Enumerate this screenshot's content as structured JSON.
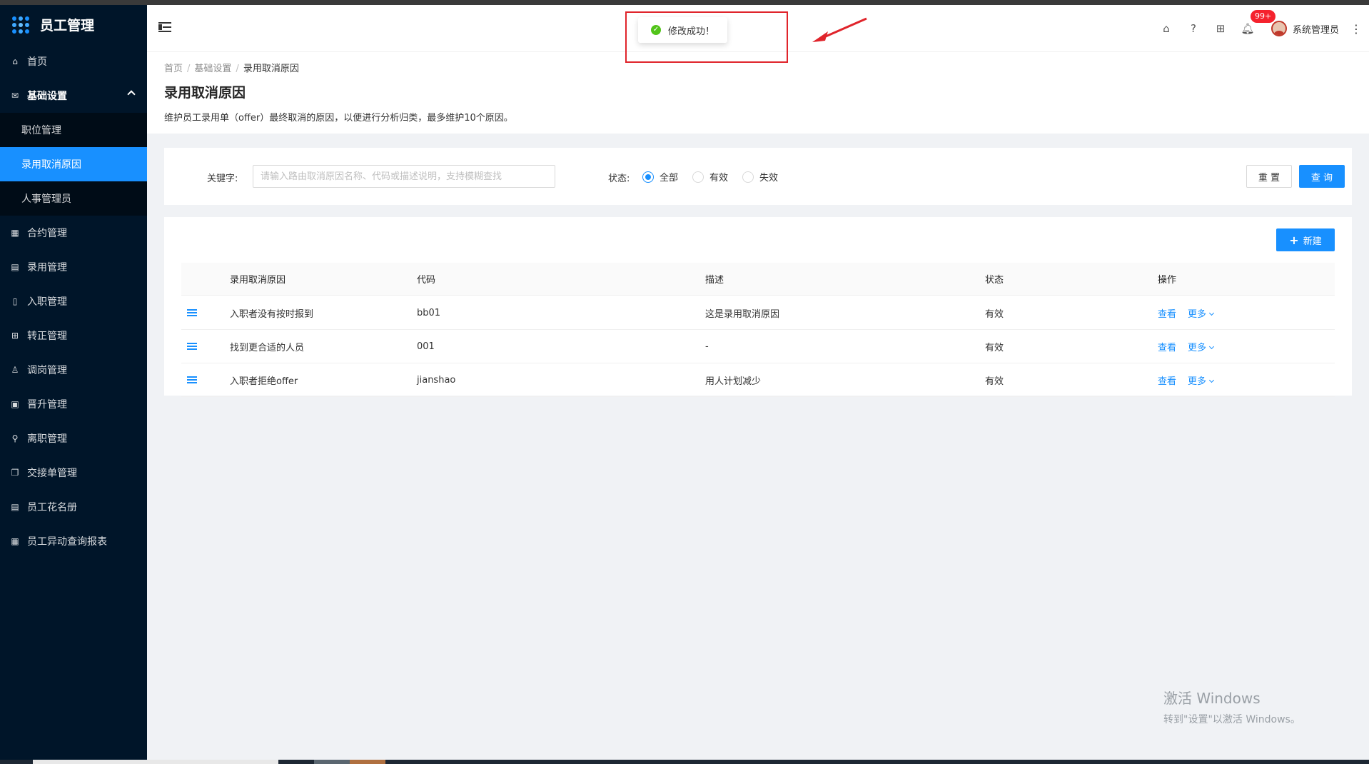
{
  "app": {
    "title": "员工管理"
  },
  "sidebar": {
    "items": [
      {
        "label": "首页",
        "icon": "home-icon",
        "glyph": "⌂"
      },
      {
        "label": "基础设置",
        "icon": "mail-icon",
        "glyph": "✉",
        "open": true,
        "children": [
          {
            "label": "职位管理"
          },
          {
            "label": "录用取消原因",
            "active": true
          },
          {
            "label": "人事管理员"
          }
        ]
      },
      {
        "label": "合约管理",
        "icon": "calendar-icon",
        "glyph": "▦"
      },
      {
        "label": "录用管理",
        "icon": "profile-icon",
        "glyph": "▤"
      },
      {
        "label": "入职管理",
        "icon": "book-icon",
        "glyph": "▯"
      },
      {
        "label": "转正管理",
        "icon": "apps-icon",
        "glyph": "⊞"
      },
      {
        "label": "调岗管理",
        "icon": "user-icon",
        "glyph": "♙"
      },
      {
        "label": "晋升管理",
        "icon": "file-icon",
        "glyph": "▣"
      },
      {
        "label": "离职管理",
        "icon": "user-leave-icon",
        "glyph": "⚲"
      },
      {
        "label": "交接单管理",
        "icon": "copy-icon",
        "glyph": "❐"
      },
      {
        "label": "员工花名册",
        "icon": "roster-icon",
        "glyph": "▤"
      },
      {
        "label": "员工异动查询报表",
        "icon": "report-icon",
        "glyph": "▦"
      }
    ]
  },
  "header": {
    "badge": "99+",
    "username": "系统管理员",
    "icons": [
      "home-icon",
      "question-icon",
      "grid-icon",
      "bell-icon"
    ]
  },
  "toast": {
    "message": "修改成功！"
  },
  "breadcrumb": [
    "首页",
    "基础设置",
    "录用取消原因"
  ],
  "page": {
    "title": "录用取消原因",
    "description": "维护员工录用单（offer）最终取消的原因，以便进行分析归类，最多维护10个原因。"
  },
  "filter": {
    "keyword_label": "关键字:",
    "keyword_value": "",
    "keyword_placeholder": "请输入路由取消原因名称、代码或描述说明，支持模糊查找",
    "status_label": "状态:",
    "status_options": [
      "全部",
      "有效",
      "失效"
    ],
    "status_selected": "全部",
    "reset_label": "重 置",
    "query_label": "查 询"
  },
  "table": {
    "new_label": "新建",
    "columns": [
      "录用取消原因",
      "代码",
      "描述",
      "状态",
      "操作"
    ],
    "rows": [
      {
        "name": "入职者没有按时报到",
        "code": "bb01",
        "desc": "这是录用取消原因",
        "status": "有效"
      },
      {
        "name": "找到更合适的人员",
        "code": "001",
        "desc": "-",
        "status": "有效"
      },
      {
        "name": "入职者拒绝offer",
        "code": "jianshao",
        "desc": "用人计划减少",
        "status": "有效"
      }
    ],
    "view_label": "查看",
    "more_label": "更多"
  },
  "watermark": {
    "line1": "激活 Windows",
    "line2": "转到\"设置\"以激活 Windows。"
  },
  "colors": {
    "primary": "#1890ff",
    "sidebar": "#001529",
    "success": "#52c41a",
    "annotation": "#e0242b"
  }
}
